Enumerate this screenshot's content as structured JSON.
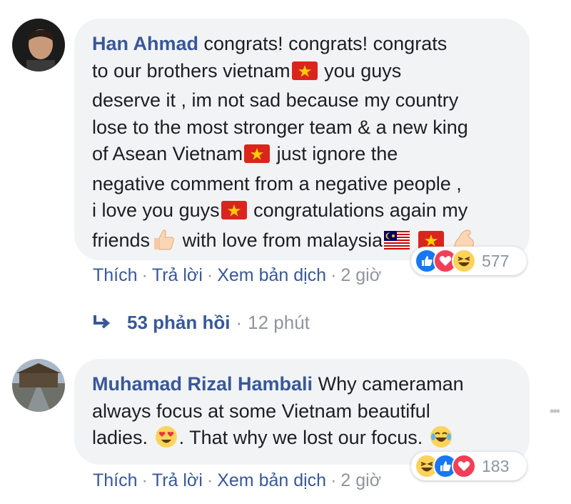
{
  "comments": [
    {
      "author": "Han Ahmad",
      "text_line1": "congrats! congrats! congrats",
      "text_line2": "to our brothers vietnam",
      "text_line2b": "you guys",
      "text_line3": "deserve it , im not sad because my country",
      "text_line4": "lose to the most stronger team & a new king",
      "text_line5": "of Asean Vietnam",
      "text_line5b": "just ignore the",
      "text_line6": "negative comment from a negative people ,",
      "text_line7": "i love you guys",
      "text_line7b": "congratulations again my",
      "text_line8": "friends",
      "text_line8b": "with love from malaysia",
      "reaction_count": "577",
      "actions": {
        "like": "Thích",
        "reply": "Trả lời",
        "translate": "Xem bản dịch",
        "time": "2 giờ"
      },
      "replies": {
        "count_label": "53 phản hồi",
        "time": "12 phút"
      }
    },
    {
      "author": "Muhamad Rizal Hambali",
      "text_line1": "Why cameraman",
      "text_line2": "always focus at some Vietnam beautiful",
      "text_line3": "ladies.",
      "text_line3b": ". That why we lost our focus.",
      "reaction_count": "183",
      "actions": {
        "like": "Thích",
        "reply": "Trả lời",
        "translate": "Xem bản dịch",
        "time": "2 giờ"
      }
    }
  ],
  "colors": {
    "author": "#385898",
    "bubble": "#f2f3f5",
    "meta": "#90949c",
    "like_blue": "#1877f2",
    "love_red": "#f33e58",
    "haha_yellow": "#fcd35b"
  }
}
